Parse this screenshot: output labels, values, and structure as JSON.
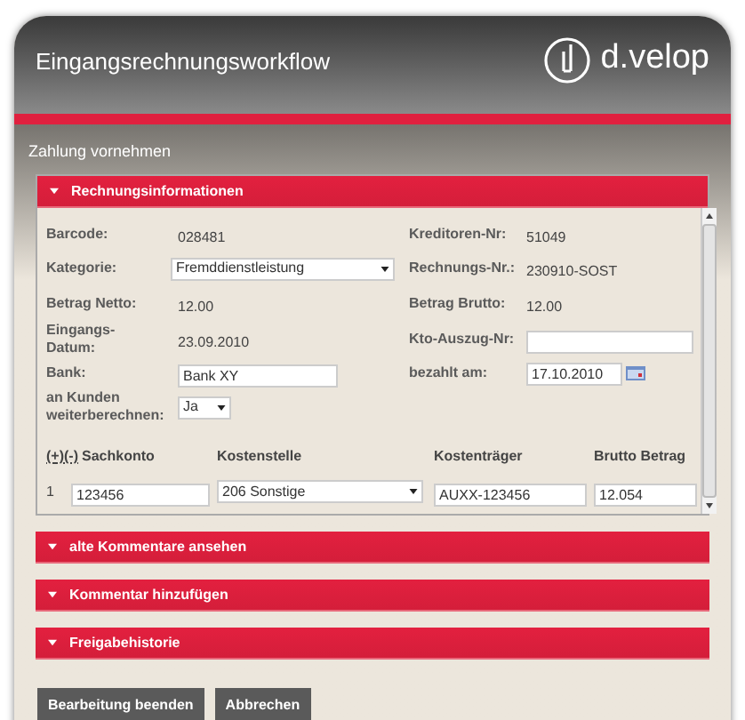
{
  "header": {
    "title": "Eingangsrechnungsworkflow",
    "logo_text": "d.velop"
  },
  "subtitle": "Zahlung vornehmen",
  "main_section": {
    "title": "Rechnungsinformationen"
  },
  "form_rows": [
    {
      "left": {
        "label": "Barcode:",
        "kind": "text",
        "value": "028481"
      },
      "right": {
        "label": "Kreditoren-Nr:",
        "kind": "text",
        "value": "51049"
      }
    },
    {
      "left": {
        "label": "Kategorie:",
        "kind": "select",
        "value": "Fremddienstleistung"
      },
      "right": {
        "label": "Rechnungs-Nr.:",
        "kind": "text",
        "value": "230910-SOST"
      }
    },
    {
      "left": {
        "label": "Betrag Netto:",
        "kind": "text",
        "value": "12.00"
      },
      "right": {
        "label": "Betrag Brutto:",
        "kind": "text",
        "value": "12.00"
      }
    },
    {
      "left": {
        "label": "Eingangs-Datum:",
        "kind": "text",
        "value": "23.09.2010"
      },
      "right": {
        "label": "Kto-Auszug-Nr:",
        "kind": "input"
      }
    },
    {
      "left": {
        "label": "Bank:",
        "kind": "input",
        "value": "Bank XY"
      },
      "right": {
        "label": "bezahlt am:",
        "kind": "date",
        "value": "17.10.2010"
      }
    },
    {
      "left": {
        "label": "an Kunden weiterberechnen:",
        "kind": "small_select",
        "value": "Ja"
      }
    }
  ],
  "table": {
    "add_link": "(+)",
    "remove_link": "(-)",
    "columns": [
      "Sachkonto",
      "Kostenstelle",
      "Kostenträger",
      "Brutto Betrag"
    ],
    "rows": [
      {
        "number": "1",
        "cells": [
          {
            "kind": "input",
            "value": "123456"
          },
          {
            "kind": "select",
            "value": "206 Sonstige"
          },
          {
            "kind": "input",
            "value": "AUXX-123456"
          },
          {
            "kind": "input",
            "value": "12.054"
          }
        ]
      }
    ]
  },
  "sections": [
    {
      "title": "alte Kommentare ansehen"
    },
    {
      "title": "Kommentar hinzufügen"
    },
    {
      "title": "Freigabehistorie"
    }
  ],
  "buttons": [
    "Bearbeitung beenden",
    "Abbrechen"
  ]
}
